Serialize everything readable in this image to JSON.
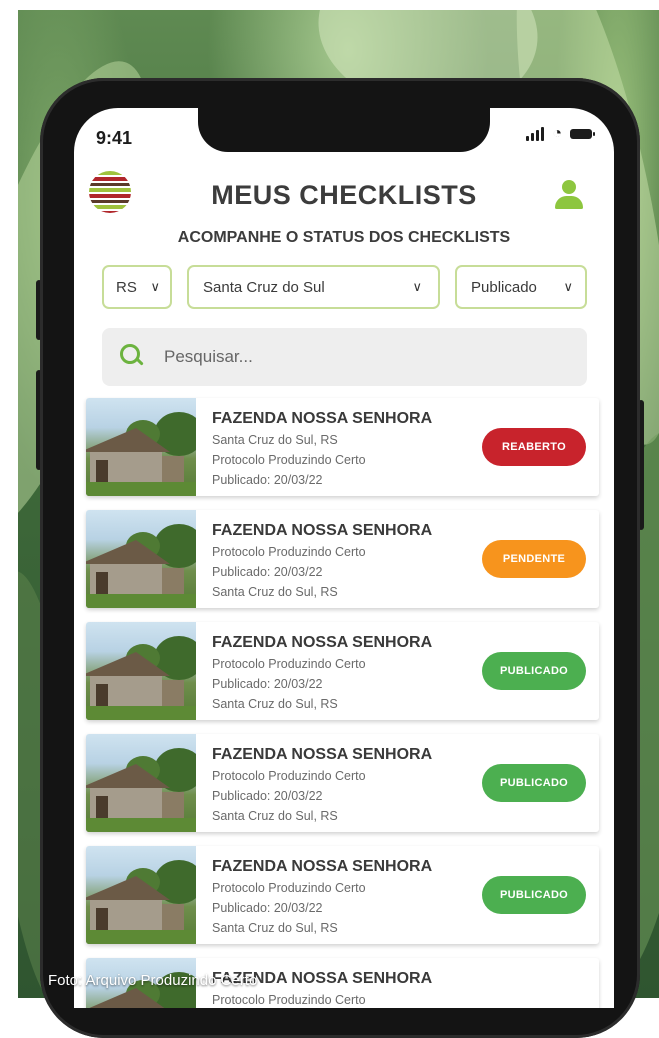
{
  "status_bar": {
    "time": "9:41"
  },
  "header": {
    "title": "MEUS CHECKLISTS",
    "subtitle": "ACOMPANHE O STATUS DOS CHECKLISTS"
  },
  "filters": {
    "state": "RS",
    "city": "Santa Cruz do Sul",
    "status": "Publicado"
  },
  "search": {
    "placeholder": "Pesquisar..."
  },
  "checklists": [
    {
      "title": "FAZENDA NOSSA SENHORA",
      "lines": [
        "Santa Cruz do Sul, RS",
        "Protocolo Produzindo Certo",
        "Publicado: 20/03/22"
      ],
      "status": "REABERTO",
      "status_color": "#c8232c"
    },
    {
      "title": "FAZENDA NOSSA SENHORA",
      "lines": [
        "Protocolo Produzindo Certo",
        "Publicado: 20/03/22",
        "Santa Cruz do Sul, RS"
      ],
      "status": "PENDENTE",
      "status_color": "#f7941d"
    },
    {
      "title": "FAZENDA NOSSA SENHORA",
      "lines": [
        "Protocolo Produzindo Certo",
        "Publicado: 20/03/22",
        "Santa Cruz do Sul, RS"
      ],
      "status": "PUBLICADO",
      "status_color": "#4caf50"
    },
    {
      "title": "FAZENDA NOSSA SENHORA",
      "lines": [
        "Protocolo Produzindo Certo",
        "Publicado: 20/03/22",
        "Santa Cruz do Sul, RS"
      ],
      "status": "PUBLICADO",
      "status_color": "#4caf50"
    },
    {
      "title": "FAZENDA NOSSA SENHORA",
      "lines": [
        "Protocolo Produzindo Certo",
        "Publicado: 20/03/22",
        "Santa Cruz do Sul, RS"
      ],
      "status": "PUBLICADO",
      "status_color": "#4caf50"
    },
    {
      "title": "FAZENDA NOSSA SENHORA",
      "lines": [
        "Protocolo Produzindo Certo"
      ],
      "status": "",
      "status_color": "#4caf50"
    }
  ],
  "photo_credit": "Foto: Arquivo Produzindo Certo",
  "colors": {
    "accent": "#8dc63f",
    "filter_border": "#c7dd98"
  }
}
